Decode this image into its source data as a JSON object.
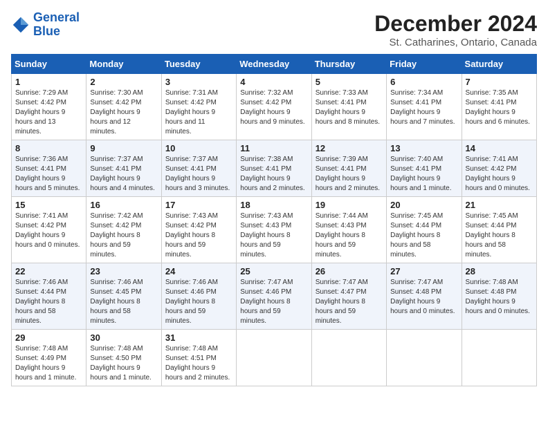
{
  "logo": {
    "line1": "General",
    "line2": "Blue"
  },
  "title": "December 2024",
  "location": "St. Catharines, Ontario, Canada",
  "headers": [
    "Sunday",
    "Monday",
    "Tuesday",
    "Wednesday",
    "Thursday",
    "Friday",
    "Saturday"
  ],
  "weeks": [
    [
      {
        "day": "1",
        "sunrise": "7:29 AM",
        "sunset": "4:42 PM",
        "daylight": "9 hours and 13 minutes."
      },
      {
        "day": "2",
        "sunrise": "7:30 AM",
        "sunset": "4:42 PM",
        "daylight": "9 hours and 12 minutes."
      },
      {
        "day": "3",
        "sunrise": "7:31 AM",
        "sunset": "4:42 PM",
        "daylight": "9 hours and 11 minutes."
      },
      {
        "day": "4",
        "sunrise": "7:32 AM",
        "sunset": "4:42 PM",
        "daylight": "9 hours and 9 minutes."
      },
      {
        "day": "5",
        "sunrise": "7:33 AM",
        "sunset": "4:41 PM",
        "daylight": "9 hours and 8 minutes."
      },
      {
        "day": "6",
        "sunrise": "7:34 AM",
        "sunset": "4:41 PM",
        "daylight": "9 hours and 7 minutes."
      },
      {
        "day": "7",
        "sunrise": "7:35 AM",
        "sunset": "4:41 PM",
        "daylight": "9 hours and 6 minutes."
      }
    ],
    [
      {
        "day": "8",
        "sunrise": "7:36 AM",
        "sunset": "4:41 PM",
        "daylight": "9 hours and 5 minutes."
      },
      {
        "day": "9",
        "sunrise": "7:37 AM",
        "sunset": "4:41 PM",
        "daylight": "9 hours and 4 minutes."
      },
      {
        "day": "10",
        "sunrise": "7:37 AM",
        "sunset": "4:41 PM",
        "daylight": "9 hours and 3 minutes."
      },
      {
        "day": "11",
        "sunrise": "7:38 AM",
        "sunset": "4:41 PM",
        "daylight": "9 hours and 2 minutes."
      },
      {
        "day": "12",
        "sunrise": "7:39 AM",
        "sunset": "4:41 PM",
        "daylight": "9 hours and 2 minutes."
      },
      {
        "day": "13",
        "sunrise": "7:40 AM",
        "sunset": "4:41 PM",
        "daylight": "9 hours and 1 minute."
      },
      {
        "day": "14",
        "sunrise": "7:41 AM",
        "sunset": "4:42 PM",
        "daylight": "9 hours and 0 minutes."
      }
    ],
    [
      {
        "day": "15",
        "sunrise": "7:41 AM",
        "sunset": "4:42 PM",
        "daylight": "9 hours and 0 minutes."
      },
      {
        "day": "16",
        "sunrise": "7:42 AM",
        "sunset": "4:42 PM",
        "daylight": "8 hours and 59 minutes."
      },
      {
        "day": "17",
        "sunrise": "7:43 AM",
        "sunset": "4:42 PM",
        "daylight": "8 hours and 59 minutes."
      },
      {
        "day": "18",
        "sunrise": "7:43 AM",
        "sunset": "4:43 PM",
        "daylight": "8 hours and 59 minutes."
      },
      {
        "day": "19",
        "sunrise": "7:44 AM",
        "sunset": "4:43 PM",
        "daylight": "8 hours and 59 minutes."
      },
      {
        "day": "20",
        "sunrise": "7:45 AM",
        "sunset": "4:44 PM",
        "daylight": "8 hours and 58 minutes."
      },
      {
        "day": "21",
        "sunrise": "7:45 AM",
        "sunset": "4:44 PM",
        "daylight": "8 hours and 58 minutes."
      }
    ],
    [
      {
        "day": "22",
        "sunrise": "7:46 AM",
        "sunset": "4:44 PM",
        "daylight": "8 hours and 58 minutes."
      },
      {
        "day": "23",
        "sunrise": "7:46 AM",
        "sunset": "4:45 PM",
        "daylight": "8 hours and 58 minutes."
      },
      {
        "day": "24",
        "sunrise": "7:46 AM",
        "sunset": "4:46 PM",
        "daylight": "8 hours and 59 minutes."
      },
      {
        "day": "25",
        "sunrise": "7:47 AM",
        "sunset": "4:46 PM",
        "daylight": "8 hours and 59 minutes."
      },
      {
        "day": "26",
        "sunrise": "7:47 AM",
        "sunset": "4:47 PM",
        "daylight": "8 hours and 59 minutes."
      },
      {
        "day": "27",
        "sunrise": "7:47 AM",
        "sunset": "4:48 PM",
        "daylight": "9 hours and 0 minutes."
      },
      {
        "day": "28",
        "sunrise": "7:48 AM",
        "sunset": "4:48 PM",
        "daylight": "9 hours and 0 minutes."
      }
    ],
    [
      {
        "day": "29",
        "sunrise": "7:48 AM",
        "sunset": "4:49 PM",
        "daylight": "9 hours and 1 minute."
      },
      {
        "day": "30",
        "sunrise": "7:48 AM",
        "sunset": "4:50 PM",
        "daylight": "9 hours and 1 minute."
      },
      {
        "day": "31",
        "sunrise": "7:48 AM",
        "sunset": "4:51 PM",
        "daylight": "9 hours and 2 minutes."
      },
      null,
      null,
      null,
      null
    ]
  ],
  "labels": {
    "sunrise": "Sunrise:",
    "sunset": "Sunset:",
    "daylight": "Daylight hours"
  }
}
